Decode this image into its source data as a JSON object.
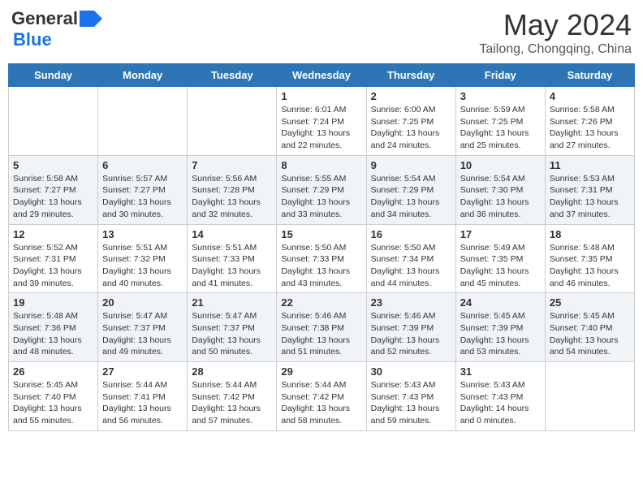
{
  "header": {
    "logo_line1": "General",
    "logo_line2": "Blue",
    "month": "May 2024",
    "location": "Tailong, Chongqing, China"
  },
  "days_of_week": [
    "Sunday",
    "Monday",
    "Tuesday",
    "Wednesday",
    "Thursday",
    "Friday",
    "Saturday"
  ],
  "weeks": [
    [
      {
        "day": "",
        "sunrise": "",
        "sunset": "",
        "daylight": ""
      },
      {
        "day": "",
        "sunrise": "",
        "sunset": "",
        "daylight": ""
      },
      {
        "day": "",
        "sunrise": "",
        "sunset": "",
        "daylight": ""
      },
      {
        "day": "1",
        "sunrise": "Sunrise: 6:01 AM",
        "sunset": "Sunset: 7:24 PM",
        "daylight": "Daylight: 13 hours and 22 minutes."
      },
      {
        "day": "2",
        "sunrise": "Sunrise: 6:00 AM",
        "sunset": "Sunset: 7:25 PM",
        "daylight": "Daylight: 13 hours and 24 minutes."
      },
      {
        "day": "3",
        "sunrise": "Sunrise: 5:59 AM",
        "sunset": "Sunset: 7:25 PM",
        "daylight": "Daylight: 13 hours and 25 minutes."
      },
      {
        "day": "4",
        "sunrise": "Sunrise: 5:58 AM",
        "sunset": "Sunset: 7:26 PM",
        "daylight": "Daylight: 13 hours and 27 minutes."
      }
    ],
    [
      {
        "day": "5",
        "sunrise": "Sunrise: 5:58 AM",
        "sunset": "Sunset: 7:27 PM",
        "daylight": "Daylight: 13 hours and 29 minutes."
      },
      {
        "day": "6",
        "sunrise": "Sunrise: 5:57 AM",
        "sunset": "Sunset: 7:27 PM",
        "daylight": "Daylight: 13 hours and 30 minutes."
      },
      {
        "day": "7",
        "sunrise": "Sunrise: 5:56 AM",
        "sunset": "Sunset: 7:28 PM",
        "daylight": "Daylight: 13 hours and 32 minutes."
      },
      {
        "day": "8",
        "sunrise": "Sunrise: 5:55 AM",
        "sunset": "Sunset: 7:29 PM",
        "daylight": "Daylight: 13 hours and 33 minutes."
      },
      {
        "day": "9",
        "sunrise": "Sunrise: 5:54 AM",
        "sunset": "Sunset: 7:29 PM",
        "daylight": "Daylight: 13 hours and 34 minutes."
      },
      {
        "day": "10",
        "sunrise": "Sunrise: 5:54 AM",
        "sunset": "Sunset: 7:30 PM",
        "daylight": "Daylight: 13 hours and 36 minutes."
      },
      {
        "day": "11",
        "sunrise": "Sunrise: 5:53 AM",
        "sunset": "Sunset: 7:31 PM",
        "daylight": "Daylight: 13 hours and 37 minutes."
      }
    ],
    [
      {
        "day": "12",
        "sunrise": "Sunrise: 5:52 AM",
        "sunset": "Sunset: 7:31 PM",
        "daylight": "Daylight: 13 hours and 39 minutes."
      },
      {
        "day": "13",
        "sunrise": "Sunrise: 5:51 AM",
        "sunset": "Sunset: 7:32 PM",
        "daylight": "Daylight: 13 hours and 40 minutes."
      },
      {
        "day": "14",
        "sunrise": "Sunrise: 5:51 AM",
        "sunset": "Sunset: 7:33 PM",
        "daylight": "Daylight: 13 hours and 41 minutes."
      },
      {
        "day": "15",
        "sunrise": "Sunrise: 5:50 AM",
        "sunset": "Sunset: 7:33 PM",
        "daylight": "Daylight: 13 hours and 43 minutes."
      },
      {
        "day": "16",
        "sunrise": "Sunrise: 5:50 AM",
        "sunset": "Sunset: 7:34 PM",
        "daylight": "Daylight: 13 hours and 44 minutes."
      },
      {
        "day": "17",
        "sunrise": "Sunrise: 5:49 AM",
        "sunset": "Sunset: 7:35 PM",
        "daylight": "Daylight: 13 hours and 45 minutes."
      },
      {
        "day": "18",
        "sunrise": "Sunrise: 5:48 AM",
        "sunset": "Sunset: 7:35 PM",
        "daylight": "Daylight: 13 hours and 46 minutes."
      }
    ],
    [
      {
        "day": "19",
        "sunrise": "Sunrise: 5:48 AM",
        "sunset": "Sunset: 7:36 PM",
        "daylight": "Daylight: 13 hours and 48 minutes."
      },
      {
        "day": "20",
        "sunrise": "Sunrise: 5:47 AM",
        "sunset": "Sunset: 7:37 PM",
        "daylight": "Daylight: 13 hours and 49 minutes."
      },
      {
        "day": "21",
        "sunrise": "Sunrise: 5:47 AM",
        "sunset": "Sunset: 7:37 PM",
        "daylight": "Daylight: 13 hours and 50 minutes."
      },
      {
        "day": "22",
        "sunrise": "Sunrise: 5:46 AM",
        "sunset": "Sunset: 7:38 PM",
        "daylight": "Daylight: 13 hours and 51 minutes."
      },
      {
        "day": "23",
        "sunrise": "Sunrise: 5:46 AM",
        "sunset": "Sunset: 7:39 PM",
        "daylight": "Daylight: 13 hours and 52 minutes."
      },
      {
        "day": "24",
        "sunrise": "Sunrise: 5:45 AM",
        "sunset": "Sunset: 7:39 PM",
        "daylight": "Daylight: 13 hours and 53 minutes."
      },
      {
        "day": "25",
        "sunrise": "Sunrise: 5:45 AM",
        "sunset": "Sunset: 7:40 PM",
        "daylight": "Daylight: 13 hours and 54 minutes."
      }
    ],
    [
      {
        "day": "26",
        "sunrise": "Sunrise: 5:45 AM",
        "sunset": "Sunset: 7:40 PM",
        "daylight": "Daylight: 13 hours and 55 minutes."
      },
      {
        "day": "27",
        "sunrise": "Sunrise: 5:44 AM",
        "sunset": "Sunset: 7:41 PM",
        "daylight": "Daylight: 13 hours and 56 minutes."
      },
      {
        "day": "28",
        "sunrise": "Sunrise: 5:44 AM",
        "sunset": "Sunset: 7:42 PM",
        "daylight": "Daylight: 13 hours and 57 minutes."
      },
      {
        "day": "29",
        "sunrise": "Sunrise: 5:44 AM",
        "sunset": "Sunset: 7:42 PM",
        "daylight": "Daylight: 13 hours and 58 minutes."
      },
      {
        "day": "30",
        "sunrise": "Sunrise: 5:43 AM",
        "sunset": "Sunset: 7:43 PM",
        "daylight": "Daylight: 13 hours and 59 minutes."
      },
      {
        "day": "31",
        "sunrise": "Sunrise: 5:43 AM",
        "sunset": "Sunset: 7:43 PM",
        "daylight": "Daylight: 14 hours and 0 minutes."
      },
      {
        "day": "",
        "sunrise": "",
        "sunset": "",
        "daylight": ""
      }
    ]
  ]
}
